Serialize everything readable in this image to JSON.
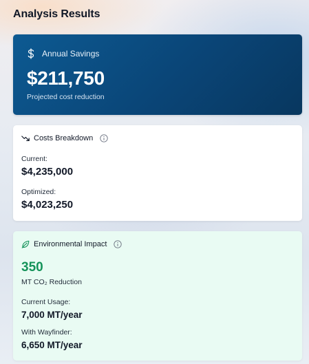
{
  "page": {
    "title": "Analysis Results"
  },
  "savings": {
    "icon": "dollar-icon",
    "label": "Annual Savings",
    "amount": "$211,750",
    "subtitle": "Projected cost reduction"
  },
  "costs": {
    "icon": "trending-down-icon",
    "title": "Costs Breakdown",
    "info_icon": "info-icon",
    "current_label": "Current:",
    "current_value": "$4,235,000",
    "optimized_label": "Optimized:",
    "optimized_value": "$4,023,250"
  },
  "environment": {
    "icon": "leaf-icon",
    "title": "Environmental Impact",
    "info_icon": "info-icon",
    "reduction_value": "350",
    "reduction_unit": "MT CO₂ Reduction",
    "current_usage_label": "Current Usage:",
    "current_usage_value": "7,000 MT/year",
    "with_label": "With Wayfinder:",
    "with_value": "6,650 MT/year",
    "accent_color": "#15935a"
  }
}
